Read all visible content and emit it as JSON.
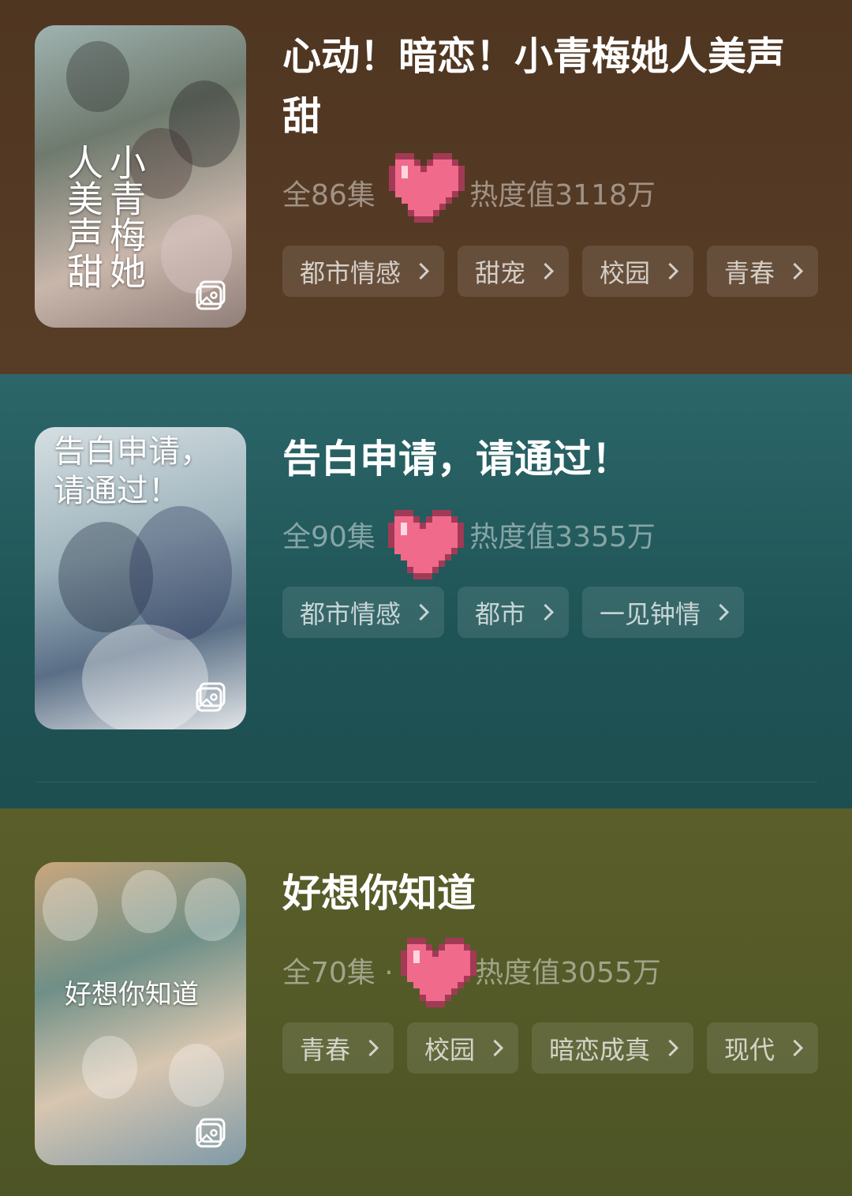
{
  "items": [
    {
      "poster_text": "小青梅她人美声甜",
      "title": "心动！暗恋！小青梅她人美声甜",
      "episodes": "全86集",
      "heat": "热度值3118万",
      "tags": [
        "都市情感",
        "甜宠",
        "校园",
        "青春"
      ]
    },
    {
      "poster_text": "告白申请，请通过！",
      "title": "告白申请，请通过！",
      "episodes": "全90集",
      "heat": "热度值3355万",
      "tags": [
        "都市情感",
        "都市",
        "一见钟情"
      ]
    },
    {
      "poster_text": "好想你知道",
      "title": "好想你知道",
      "episodes": "全70集 ·",
      "heat": "热度值3055万",
      "tags": [
        "青春",
        "校园",
        "暗恋成真",
        "现代"
      ]
    }
  ],
  "colors": {
    "heart": "#f06a8c",
    "card1": "#533923",
    "card2": "#245e61",
    "card3": "#565b28"
  }
}
